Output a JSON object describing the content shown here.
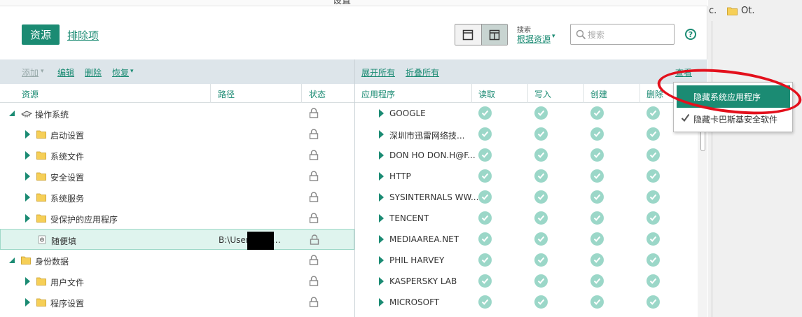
{
  "window": {
    "title": "设置"
  },
  "header": {
    "tabs": [
      {
        "label": "资源"
      },
      {
        "label": "排除项"
      }
    ],
    "search_caption": "搜索",
    "search_by": "根据资源",
    "search_placeholder": "搜索",
    "help": "?"
  },
  "toolbar": {
    "add": "添加",
    "edit": "编辑",
    "delete": "删除",
    "restore": "恢复",
    "expand_all": "展开所有",
    "collapse_all": "折叠所有",
    "view": "查看"
  },
  "left_columns": {
    "resource": "资源",
    "path": "路径",
    "status": "状态"
  },
  "right_columns": {
    "app": "应用程序",
    "read": "读取",
    "write": "写入",
    "create": "创建",
    "delete": "删除"
  },
  "tree": [
    {
      "label": "操作系统",
      "level": 0,
      "expanded": true,
      "icon": "chip-icon",
      "path": ""
    },
    {
      "label": "启动设置",
      "level": 1,
      "expanded": false,
      "icon": "folder-icon",
      "path": ""
    },
    {
      "label": "系统文件",
      "level": 1,
      "expanded": false,
      "icon": "folder-icon",
      "path": ""
    },
    {
      "label": "安全设置",
      "level": 1,
      "expanded": false,
      "icon": "folder-icon",
      "path": ""
    },
    {
      "label": "系统服务",
      "level": 1,
      "expanded": false,
      "icon": "folder-icon",
      "path": ""
    },
    {
      "label": "受保护的应用程序",
      "level": 1,
      "expanded": false,
      "icon": "folder-icon",
      "path": ""
    },
    {
      "label": "随便填",
      "level": 1,
      "expanded": null,
      "icon": "gear-file-icon",
      "path": "B:\\Users        Des…",
      "selected": true
    },
    {
      "label": "身份数据",
      "level": 0,
      "expanded": true,
      "icon": "folder-icon",
      "path": ""
    },
    {
      "label": "用户文件",
      "level": 1,
      "expanded": false,
      "icon": "folder-icon",
      "path": ""
    },
    {
      "label": "程序设置",
      "level": 1,
      "expanded": false,
      "icon": "folder-icon",
      "path": ""
    }
  ],
  "apps": [
    {
      "name": "GOOGLE"
    },
    {
      "name": "深圳市迅雷网络技..."
    },
    {
      "name": "DON HO DON.H@F..."
    },
    {
      "name": "HTTP"
    },
    {
      "name": "SYSINTERNALS WW..."
    },
    {
      "name": "TENCENT"
    },
    {
      "name": "MEDIAAREA.NET"
    },
    {
      "name": "PHIL HARVEY"
    },
    {
      "name": "KASPERSKY LAB"
    },
    {
      "name": "MICROSOFT"
    }
  ],
  "view_menu": {
    "items": [
      {
        "label": "隐藏系统应用程序",
        "highlighted": true
      },
      {
        "label": "隐藏卡巴斯基安全软件",
        "checked": true
      }
    ]
  },
  "explorer_bg": {
    "cut_text": "c.",
    "folder_label": "Ot."
  },
  "colors": {
    "accent": "#1b8b73",
    "check": "#9bd7c8",
    "toolbar": "#dde5ea",
    "annotation": "#e3101c"
  }
}
